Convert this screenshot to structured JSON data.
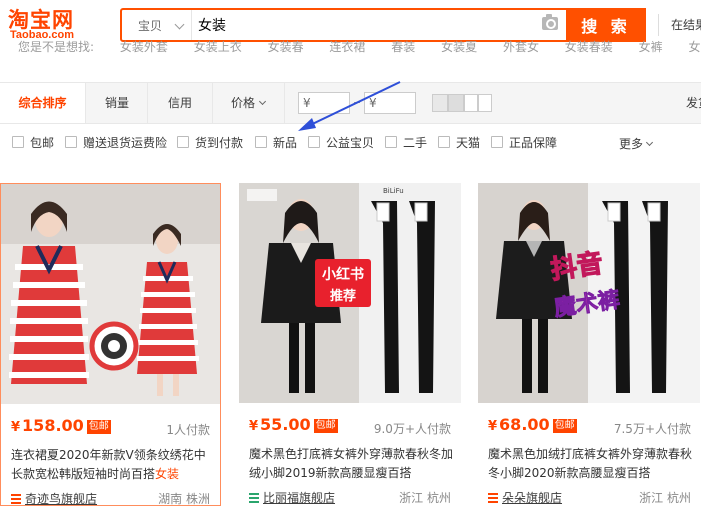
{
  "header": {
    "logo_main": "淘宝网",
    "logo_sub": "Taobao.com",
    "search_scope": "宝贝",
    "search_value": "女装",
    "search_button": "搜 索",
    "in_store": "在结果"
  },
  "related": [
    "您是不是想找:",
    "女装外套",
    "女装上衣",
    "女装春",
    "连衣裙",
    "春装",
    "女装夏",
    "外套女",
    "女装春装",
    "女裤",
    "女上衣"
  ],
  "sortbar": {
    "items": [
      "综合排序",
      "销量",
      "信用",
      "价格"
    ],
    "price_from": "¥",
    "price_to": "¥",
    "ship_label": "发货"
  },
  "filters": {
    "items": [
      "包邮",
      "赠送退货运费险",
      "货到付款",
      "新品",
      "公益宝贝",
      "二手",
      "天猫",
      "正品保障"
    ],
    "more": "更多"
  },
  "products": [
    {
      "price": "158.00",
      "yen": "¥",
      "badge": "包邮",
      "sold": "1人付款",
      "title_prefix": "连衣裙夏2020年新款V领条纹绣花中长款宽松韩版短袖时尚百搭",
      "title_keyword": "女装",
      "shop": "奇迹鸟旗舰店",
      "location": "湖南 株洲"
    },
    {
      "price": "55.00",
      "yen": "¥",
      "badge": "包邮",
      "sold": "9.0万+人付款",
      "title_prefix": "魔术黑色打底裤女裤外穿薄款春秋冬加绒小脚2019新款高腰显瘦百搭",
      "title_keyword": "",
      "shop": "比丽福旗舰店",
      "location": "浙江 杭州",
      "overlay_brand": "小红书",
      "overlay_tag": "推荐",
      "tag_text": "BiLiFu"
    },
    {
      "price": "68.00",
      "yen": "¥",
      "badge": "包邮",
      "sold": "7.5万+人付款",
      "title_prefix": "魔术黑色加绒打底裤女裤外穿薄款春秋冬小脚2020新款高腰显瘦百搭",
      "title_keyword": "",
      "shop": "朵朵旗舰店",
      "location": "浙江 杭州",
      "overlay_brand": "抖音",
      "overlay_tag": "魔术裤"
    }
  ],
  "colors": {
    "brand": "#ff4400",
    "search_border": "#ff5000",
    "annotation": "#2e4fd8"
  }
}
